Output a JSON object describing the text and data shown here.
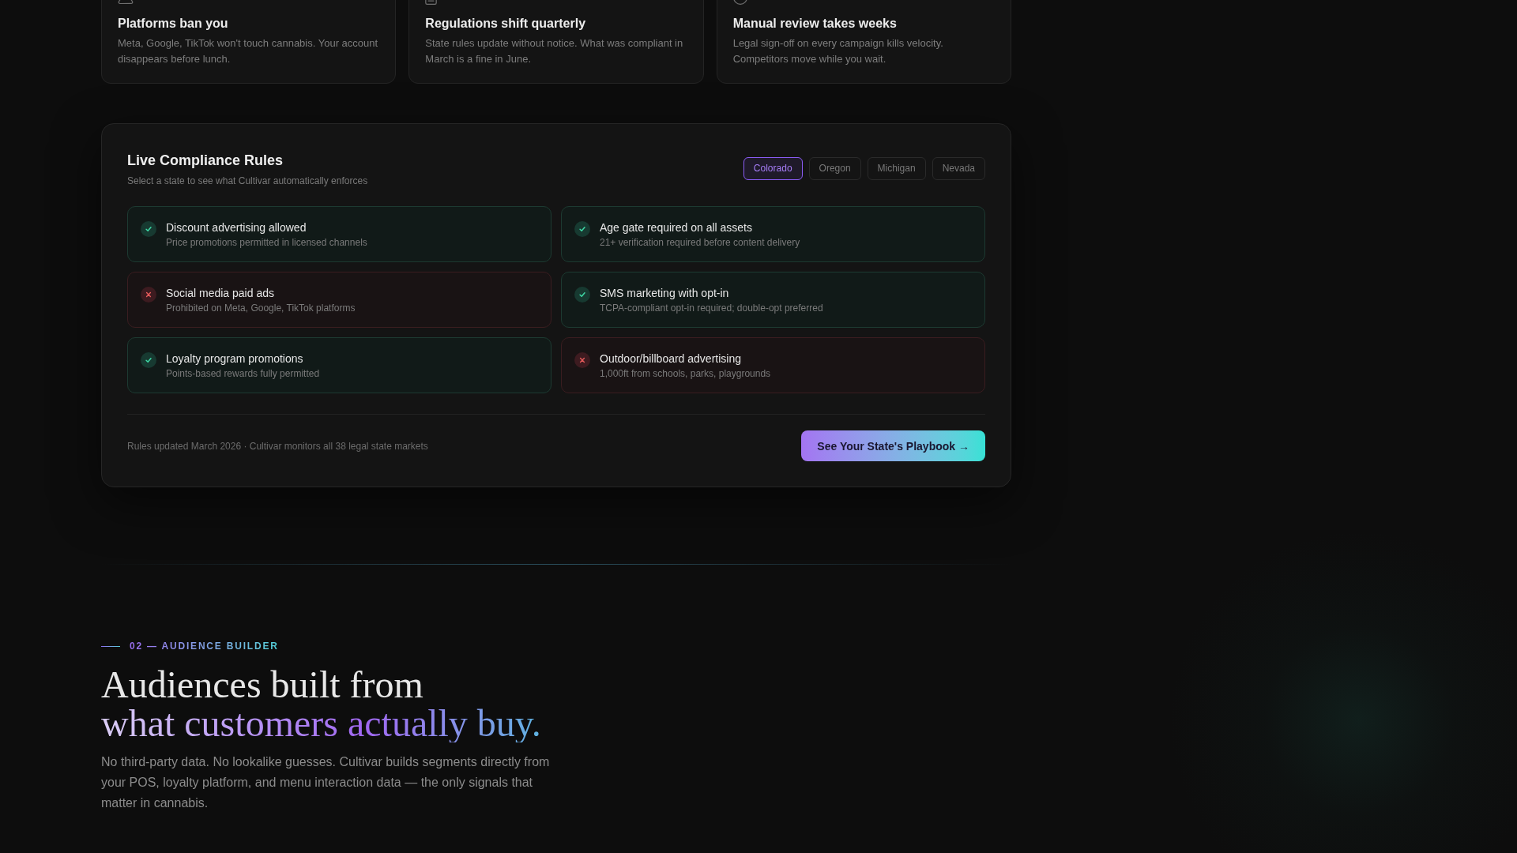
{
  "feature_cards": [
    {
      "title": "Platforms ban you",
      "description": "Meta, Google, TikTok won't touch cannabis. Your account disappears before lunch."
    },
    {
      "title": "Regulations shift quarterly",
      "description": "State rules update without notice. What was compliant in March is a fine in June."
    },
    {
      "title": "Manual review takes weeks",
      "description": "Legal sign-off on every campaign kills velocity. Competitors move while you wait."
    }
  ],
  "compliance": {
    "title": "Live Compliance Rules",
    "subtitle": "Select a state to see what Cultivar automatically enforces",
    "tabs": [
      {
        "label": "Colorado",
        "selected": true
      },
      {
        "label": "Oregon",
        "selected": false
      },
      {
        "label": "Michigan",
        "selected": false
      },
      {
        "label": "Nevada",
        "selected": false
      }
    ],
    "rules": [
      {
        "title": "Discount advertising allowed",
        "detail": "Price promotions permitted in licensed channels",
        "allowed": true
      },
      {
        "title": "Age gate required on all assets",
        "detail": "21+ verification required before content delivery",
        "allowed": true
      },
      {
        "title": "Social media paid ads",
        "detail": "Prohibited on Meta, Google, TikTok platforms",
        "allowed": false
      },
      {
        "title": "SMS marketing with opt-in",
        "detail": "TCPA-compliant opt-in required; double-opt preferred",
        "allowed": true
      },
      {
        "title": "Loyalty program promotions",
        "detail": "Points-based rewards fully permitted",
        "allowed": true
      },
      {
        "title": "Outdoor/billboard advertising",
        "detail": "1,000ft from schools, parks, playgrounds",
        "allowed": false
      }
    ],
    "footer_note": "Rules updated March 2026 · Cultivar monitors all 38 legal state markets",
    "cta": "See Your State's Playbook →"
  },
  "audience_section": {
    "eyebrow": "02 — AUDIENCE BUILDER",
    "heading": "Audiences built from",
    "heading_highlight": "what customers actually buy.",
    "body": "No third-party data. No lookalike guesses. Cultivar builds segments directly from your POS, loyalty platform, and menu interaction data — the only signals that matter in cannabis."
  }
}
